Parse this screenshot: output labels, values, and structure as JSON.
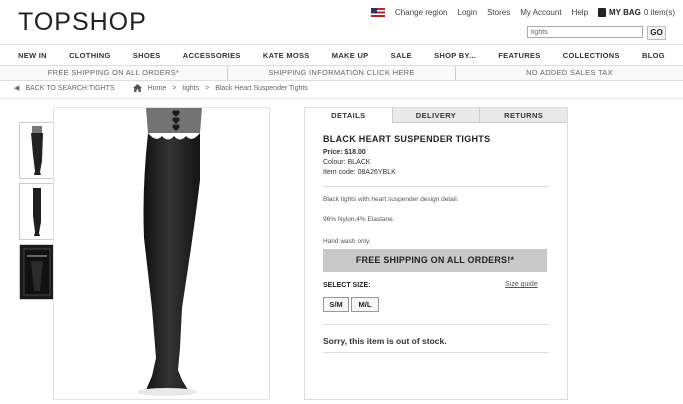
{
  "header": {
    "logo": "TOPSHOP",
    "change_region": "Change region",
    "login": "Login",
    "stores": "Stores",
    "my_account": "My Account",
    "help": "Help",
    "my_bag": "MY BAG",
    "bag_count": "0 item(s)",
    "search_value": "tights",
    "go": "GO"
  },
  "nav": [
    "NEW IN",
    "CLOTHING",
    "SHOES",
    "ACCESSORIES",
    "KATE MOSS",
    "MAKE UP",
    "SALE",
    "SHOP BY...",
    "FEATURES",
    "COLLECTIONS",
    "BLOG"
  ],
  "strip": [
    "FREE SHIPPING ON ALL ORDERS*",
    "SHIPPING INFORMATION CLICK HERE",
    "NO ADDED SALES TAX"
  ],
  "breadcrumb": {
    "back": "BACK TO SEARCH:TIGHTS",
    "home": "Home",
    "tights": "tights",
    "current": "Black Heart Suspender Tights"
  },
  "tabs": [
    "DETAILS",
    "DELIVERY",
    "RETURNS"
  ],
  "product": {
    "title": "BLACK HEART SUSPENDER TIGHTS",
    "price": "Price: $18.00",
    "colour": "Colour: BLACK",
    "item_code": "Item code: 08A26YBLK",
    "description": "Black tights with heart suspender design detail.",
    "composition": "96% Nylon,4% Elastane.",
    "care": "Hand wash only.",
    "banner": "FREE SHIPPING ON ALL ORDERS!*",
    "select_size": "SELECT SIZE:",
    "size_guide": "Size guide",
    "sizes": [
      "S/M",
      "M/L"
    ],
    "stock_message": "Sorry, this item is out of stock."
  },
  "icons": {
    "region_flag": "us-flag-icon",
    "bag": "bag-icon",
    "home": "home-icon",
    "back": "left-arrow-icon"
  },
  "colors": {
    "text": "#333333",
    "banner_bg": "#c9c9c9",
    "tab_inactive": "#e9e9e9"
  }
}
